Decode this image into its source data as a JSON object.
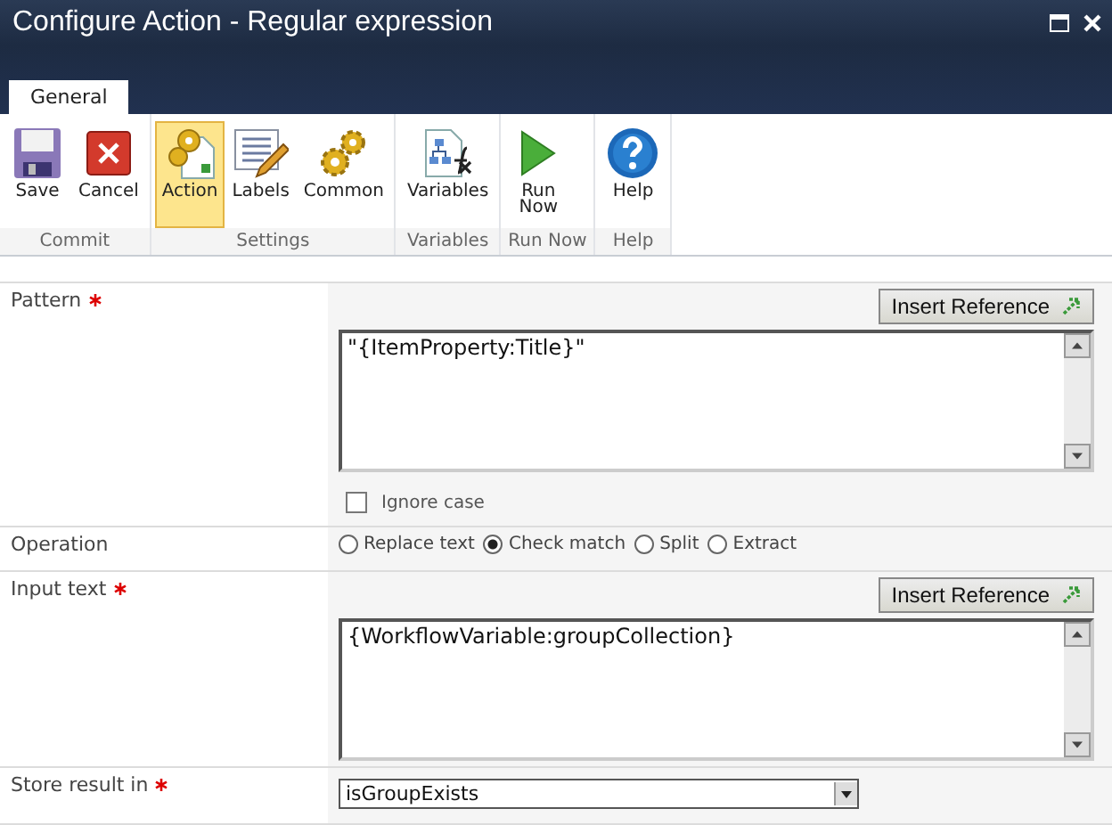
{
  "window": {
    "title": "Configure Action - Regular expression"
  },
  "tabs": [
    {
      "label": "General",
      "selected": true
    }
  ],
  "ribbon": [
    {
      "label": "Commit",
      "buttons": [
        {
          "label": "Save",
          "selected": false
        },
        {
          "label": "Cancel",
          "selected": false
        }
      ]
    },
    {
      "label": "Settings",
      "buttons": [
        {
          "label": "Action",
          "selected": true
        },
        {
          "label": "Labels",
          "selected": false
        },
        {
          "label": "Common",
          "selected": false
        }
      ]
    },
    {
      "label": "Variables",
      "buttons": [
        {
          "label": "Variables",
          "selected": false
        }
      ]
    },
    {
      "label": "Run Now",
      "buttons": [
        {
          "label": "Run\nNow",
          "selected": false
        }
      ]
    },
    {
      "label": "Help",
      "buttons": [
        {
          "label": "Help",
          "selected": false
        }
      ]
    }
  ],
  "fields": [
    {
      "kind": "textarea",
      "label": "Pattern",
      "required": true,
      "button": "Insert Reference",
      "value": "\"{ItemProperty:Title}\"",
      "checkbox": {
        "label": "Ignore case",
        "checked": false
      }
    },
    {
      "kind": "radio",
      "label": "Operation",
      "required": false,
      "options": [
        {
          "label": "Replace text",
          "selected": false
        },
        {
          "label": "Check match",
          "selected": true
        },
        {
          "label": "Split",
          "selected": false
        },
        {
          "label": "Extract",
          "selected": false
        }
      ]
    },
    {
      "kind": "textarea",
      "label": "Input text",
      "required": true,
      "button": "Insert Reference",
      "value": "{WorkflowVariable:groupCollection}"
    },
    {
      "kind": "select",
      "label": "Store result in",
      "required": true,
      "value": "isGroupExists"
    }
  ]
}
